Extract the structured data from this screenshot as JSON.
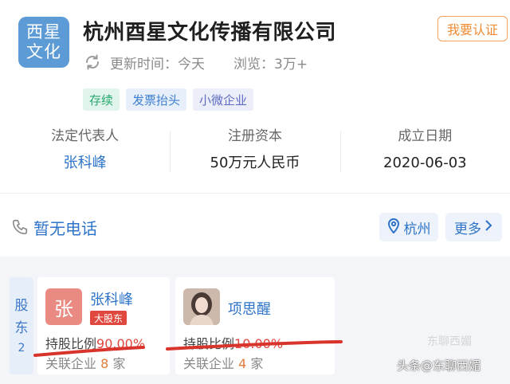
{
  "logo": {
    "line1": "西星",
    "line2": "文化"
  },
  "company": {
    "name": "杭州酉星文化传播有限公司",
    "cert_label": "我要认证"
  },
  "meta": {
    "update_label": "更新时间：今天",
    "views_label": "浏览：3万+"
  },
  "tags": [
    {
      "label": "存续"
    },
    {
      "label": "发票抬头"
    },
    {
      "label": "小微企业"
    }
  ],
  "info": {
    "legal_rep": {
      "label": "法定代表人",
      "value": "张科峰"
    },
    "capital": {
      "label": "注册资本",
      "value": "50万元人民币"
    },
    "founded": {
      "label": "成立日期",
      "value": "2020-06-03"
    }
  },
  "contact": {
    "phone": "暂无电话",
    "city": "杭州",
    "more": "更多"
  },
  "shareholders": {
    "tab_line1": "股",
    "tab_line2": "东",
    "count": "2",
    "items": [
      {
        "avatar_char": "张",
        "name": "张科峰",
        "badge": "大股东",
        "ratio_label": "持股比例",
        "ratio": "90.00%",
        "related_label": "关联企业",
        "related_count": "8",
        "related_unit": "家"
      },
      {
        "name": "项思醒",
        "ratio_label": "持股比例",
        "ratio": "10.00%",
        "related_label": "关联企业",
        "related_count": "4",
        "related_unit": "家"
      }
    ]
  },
  "watermark": {
    "text": "头条@东聊西媚",
    "faint": "东聊西媚"
  },
  "colors": {
    "accent": "#2e74c8",
    "logo_bg": "#5d9bd6",
    "red": "#e0483f",
    "orange": "#ef8a33",
    "annotation": "#d8342c"
  },
  "icons": [
    "refresh-icon",
    "phone-icon",
    "location-pin-icon",
    "chevron-right-icon"
  ]
}
